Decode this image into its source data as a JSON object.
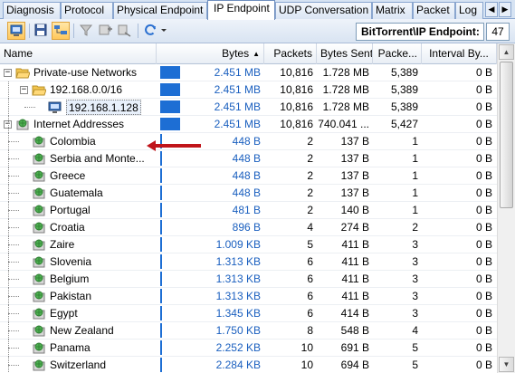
{
  "tabs": [
    {
      "label": "Diagnosis",
      "active": false
    },
    {
      "label": "Protocol",
      "active": false
    },
    {
      "label": "Physical Endpoint",
      "active": false
    },
    {
      "label": "IP Endpoint",
      "active": true
    },
    {
      "label": "UDP Conversation",
      "active": false
    },
    {
      "label": "Matrix",
      "active": false
    },
    {
      "label": "Packet",
      "active": false
    },
    {
      "label": "Log",
      "active": false
    }
  ],
  "tab_nav": {
    "prev": "◀",
    "next": "▶"
  },
  "toolbar": {
    "endpoint_label": "BitTorrent\\IP Endpoint:",
    "endpoint_count": "47",
    "icons": [
      "node-view-icon",
      "save-icon",
      "tree-view-icon",
      "filter-icon",
      "add-filter-icon",
      "locate-icon",
      "refresh-icon",
      "dropdown-arrow-icon"
    ]
  },
  "columns": {
    "name": "Name",
    "bytes": "Bytes",
    "packets": "Packets",
    "bytes_sent": "Bytes Sent",
    "packets_sent": "Packe...",
    "interval": "Interval By..."
  },
  "sort": {
    "column": "bytes",
    "direction": "descending",
    "arrow": "▲"
  },
  "colors": {
    "bar": "#1d6ed4",
    "value_text": "#1a5fbf",
    "selected_arrow": "#c0141a"
  },
  "rows": [
    {
      "name": "Private-use Networks",
      "level": 0,
      "type": "folder",
      "expander": "−",
      "bytes": "2.451 MB",
      "bar_fraction": 1.0,
      "packets": "10,816",
      "bytes_sent": "1.728 MB",
      "packets_sent": "5,389",
      "interval": "0 B"
    },
    {
      "name": "192.168.0.0/16",
      "level": 1,
      "type": "folder",
      "expander": "−",
      "bytes": "2.451 MB",
      "bar_fraction": 1.0,
      "packets": "10,816",
      "bytes_sent": "1.728 MB",
      "packets_sent": "5,389",
      "interval": "0 B"
    },
    {
      "name": "192.168.1.128",
      "level": 2,
      "type": "host",
      "expander": "",
      "bytes": "2.451 MB",
      "bar_fraction": 1.0,
      "packets": "10,816",
      "bytes_sent": "1.728 MB",
      "packets_sent": "5,389",
      "interval": "0 B",
      "highlighted": true
    },
    {
      "name": "Internet Addresses",
      "level": 0,
      "type": "network",
      "expander": "−",
      "bytes": "2.451 MB",
      "bar_fraction": 1.0,
      "packets": "10,816",
      "bytes_sent": "740.041 ...",
      "packets_sent": "5,427",
      "interval": "0 B"
    },
    {
      "name": "Colombia",
      "level": 1,
      "type": "network",
      "expander": "",
      "bytes": "448  B",
      "bar_fraction": 0,
      "packets": "2",
      "bytes_sent": "137  B",
      "packets_sent": "1",
      "interval": "0 B"
    },
    {
      "name": "Serbia and Monte...",
      "level": 1,
      "type": "network",
      "expander": "",
      "bytes": "448  B",
      "bar_fraction": 0,
      "packets": "2",
      "bytes_sent": "137  B",
      "packets_sent": "1",
      "interval": "0 B"
    },
    {
      "name": "Greece",
      "level": 1,
      "type": "network",
      "expander": "",
      "bytes": "448  B",
      "bar_fraction": 0,
      "packets": "2",
      "bytes_sent": "137  B",
      "packets_sent": "1",
      "interval": "0 B"
    },
    {
      "name": "Guatemala",
      "level": 1,
      "type": "network",
      "expander": "",
      "bytes": "448  B",
      "bar_fraction": 0,
      "packets": "2",
      "bytes_sent": "137  B",
      "packets_sent": "1",
      "interval": "0 B"
    },
    {
      "name": "Portugal",
      "level": 1,
      "type": "network",
      "expander": "",
      "bytes": "481  B",
      "bar_fraction": 0,
      "packets": "2",
      "bytes_sent": "140  B",
      "packets_sent": "1",
      "interval": "0 B"
    },
    {
      "name": "Croatia",
      "level": 1,
      "type": "network",
      "expander": "",
      "bytes": "896  B",
      "bar_fraction": 0,
      "packets": "4",
      "bytes_sent": "274  B",
      "packets_sent": "2",
      "interval": "0 B"
    },
    {
      "name": "Zaire",
      "level": 1,
      "type": "network",
      "expander": "",
      "bytes": "1.009 KB",
      "bar_fraction": 0,
      "packets": "5",
      "bytes_sent": "411  B",
      "packets_sent": "3",
      "interval": "0 B"
    },
    {
      "name": "Slovenia",
      "level": 1,
      "type": "network",
      "expander": "",
      "bytes": "1.313 KB",
      "bar_fraction": 0,
      "packets": "6",
      "bytes_sent": "411  B",
      "packets_sent": "3",
      "interval": "0 B"
    },
    {
      "name": "Belgium",
      "level": 1,
      "type": "network",
      "expander": "",
      "bytes": "1.313 KB",
      "bar_fraction": 0,
      "packets": "6",
      "bytes_sent": "411  B",
      "packets_sent": "3",
      "interval": "0 B"
    },
    {
      "name": "Pakistan",
      "level": 1,
      "type": "network",
      "expander": "",
      "bytes": "1.313 KB",
      "bar_fraction": 0,
      "packets": "6",
      "bytes_sent": "411  B",
      "packets_sent": "3",
      "interval": "0 B"
    },
    {
      "name": "Egypt",
      "level": 1,
      "type": "network",
      "expander": "",
      "bytes": "1.345 KB",
      "bar_fraction": 0,
      "packets": "6",
      "bytes_sent": "414  B",
      "packets_sent": "3",
      "interval": "0 B"
    },
    {
      "name": "New Zealand",
      "level": 1,
      "type": "network",
      "expander": "",
      "bytes": "1.750 KB",
      "bar_fraction": 0,
      "packets": "8",
      "bytes_sent": "548  B",
      "packets_sent": "4",
      "interval": "0 B"
    },
    {
      "name": "Panama",
      "level": 1,
      "type": "network",
      "expander": "",
      "bytes": "2.252 KB",
      "bar_fraction": 0,
      "packets": "10",
      "bytes_sent": "691  B",
      "packets_sent": "5",
      "interval": "0 B"
    },
    {
      "name": "Switzerland",
      "level": 1,
      "type": "network",
      "expander": "",
      "bytes": "2.284 KB",
      "bar_fraction": 0,
      "packets": "10",
      "bytes_sent": "694  B",
      "packets_sent": "5",
      "interval": "0 B"
    }
  ]
}
